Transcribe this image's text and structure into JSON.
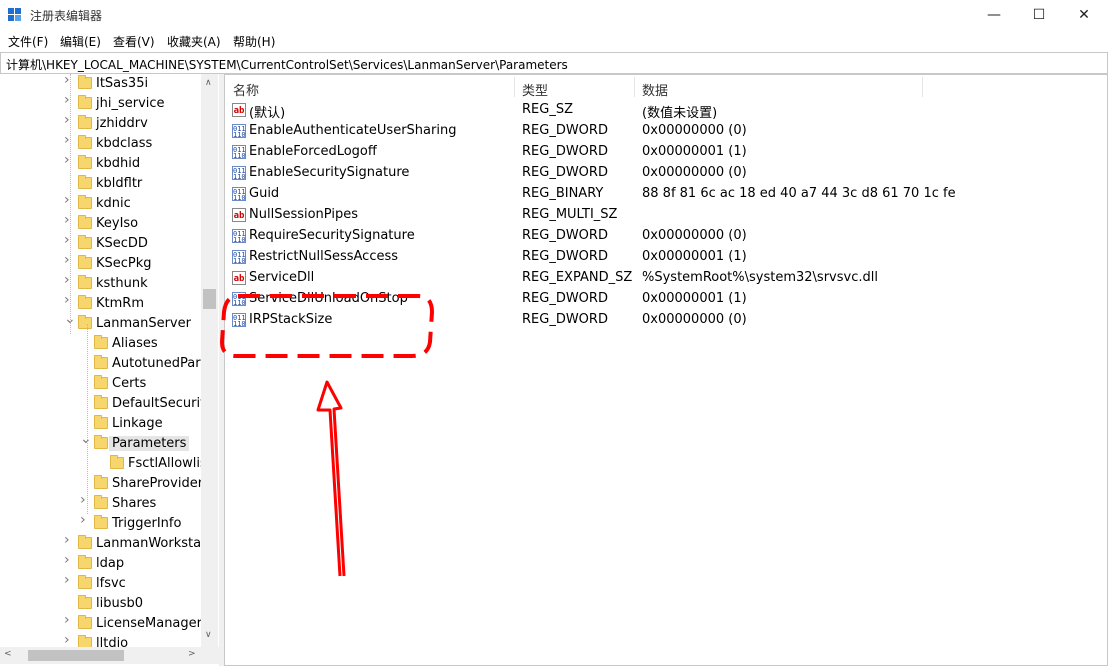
{
  "window": {
    "title": "注册表编辑器",
    "minimize": "—",
    "maximize": "☐",
    "close": "✕"
  },
  "menu": [
    "文件(F)",
    "编辑(E)",
    "查看(V)",
    "收藏夹(A)",
    "帮助(H)"
  ],
  "address": "计算机\\HKEY_LOCAL_MACHINE\\SYSTEM\\CurrentControlSet\\Services\\LanmanServer\\Parameters",
  "tree": [
    {
      "label": "ItSas35i",
      "level": 1,
      "expander": "right"
    },
    {
      "label": "jhi_service",
      "level": 1,
      "expander": "right"
    },
    {
      "label": "jzhiddrv",
      "level": 1,
      "expander": "right"
    },
    {
      "label": "kbdclass",
      "level": 1,
      "expander": "right"
    },
    {
      "label": "kbdhid",
      "level": 1,
      "expander": "right"
    },
    {
      "label": "kbldfltr",
      "level": 1,
      "expander": "none"
    },
    {
      "label": "kdnic",
      "level": 1,
      "expander": "right"
    },
    {
      "label": "KeyIso",
      "level": 1,
      "expander": "right"
    },
    {
      "label": "KSecDD",
      "level": 1,
      "expander": "right"
    },
    {
      "label": "KSecPkg",
      "level": 1,
      "expander": "right"
    },
    {
      "label": "ksthunk",
      "level": 1,
      "expander": "right"
    },
    {
      "label": "KtmRm",
      "level": 1,
      "expander": "right"
    },
    {
      "label": "LanmanServer",
      "level": 1,
      "expander": "down"
    },
    {
      "label": "Aliases",
      "level": 2,
      "expander": "none"
    },
    {
      "label": "AutotunedPara",
      "level": 2,
      "expander": "none"
    },
    {
      "label": "Certs",
      "level": 2,
      "expander": "none"
    },
    {
      "label": "DefaultSecurity",
      "level": 2,
      "expander": "none"
    },
    {
      "label": "Linkage",
      "level": 2,
      "expander": "none"
    },
    {
      "label": "Parameters",
      "level": 2,
      "expander": "down",
      "selected": true
    },
    {
      "label": "FsctlAllowlist",
      "level": 3,
      "expander": "none"
    },
    {
      "label": "ShareProviders",
      "level": 2,
      "expander": "none"
    },
    {
      "label": "Shares",
      "level": 2,
      "expander": "right"
    },
    {
      "label": "TriggerInfo",
      "level": 2,
      "expander": "right"
    },
    {
      "label": "LanmanWorkstatio",
      "level": 1,
      "expander": "right"
    },
    {
      "label": "ldap",
      "level": 1,
      "expander": "right"
    },
    {
      "label": "lfsvc",
      "level": 1,
      "expander": "right"
    },
    {
      "label": "libusb0",
      "level": 1,
      "expander": "none"
    },
    {
      "label": "LicenseManager",
      "level": 1,
      "expander": "right"
    },
    {
      "label": "lltdio",
      "level": 1,
      "expander": "right"
    }
  ],
  "list": {
    "columns": [
      "名称",
      "类型",
      "数据"
    ],
    "rows": [
      {
        "icon": "string-value-icon",
        "name": "(默认)",
        "type": "REG_SZ",
        "data": "(数值未设置)"
      },
      {
        "icon": "binary-value-icon",
        "name": "EnableAuthenticateUserSharing",
        "type": "REG_DWORD",
        "data": "0x00000000 (0)"
      },
      {
        "icon": "binary-value-icon",
        "name": "EnableForcedLogoff",
        "type": "REG_DWORD",
        "data": "0x00000001 (1)"
      },
      {
        "icon": "binary-value-icon",
        "name": "EnableSecuritySignature",
        "type": "REG_DWORD",
        "data": "0x00000000 (0)"
      },
      {
        "icon": "binary-value-icon",
        "name": "Guid",
        "type": "REG_BINARY",
        "data": "88 8f 81 6c ac 18 ed 40 a7 44 3c d8 61 70 1c fe"
      },
      {
        "icon": "string-value-icon",
        "name": "NullSessionPipes",
        "type": "REG_MULTI_SZ",
        "data": ""
      },
      {
        "icon": "binary-value-icon",
        "name": "RequireSecuritySignature",
        "type": "REG_DWORD",
        "data": "0x00000000 (0)"
      },
      {
        "icon": "binary-value-icon",
        "name": "RestrictNullSessAccess",
        "type": "REG_DWORD",
        "data": "0x00000001 (1)"
      },
      {
        "icon": "string-value-icon",
        "name": "ServiceDll",
        "type": "REG_EXPAND_SZ",
        "data": "%SystemRoot%\\system32\\srvsvc.dll"
      },
      {
        "icon": "binary-value-icon",
        "name": "ServiceDllUnloadOnStop",
        "type": "REG_DWORD",
        "data": "0x00000001 (1)"
      },
      {
        "icon": "binary-value-icon",
        "name": "IRPStackSize",
        "type": "REG_DWORD",
        "data": "0x00000000 (0)"
      }
    ]
  },
  "colors": {
    "annotation": "#ff0000",
    "selection": "#e5e5e5",
    "folder": "#f7d66d"
  },
  "icons": {
    "string": "ab",
    "binary": "011\n110"
  }
}
